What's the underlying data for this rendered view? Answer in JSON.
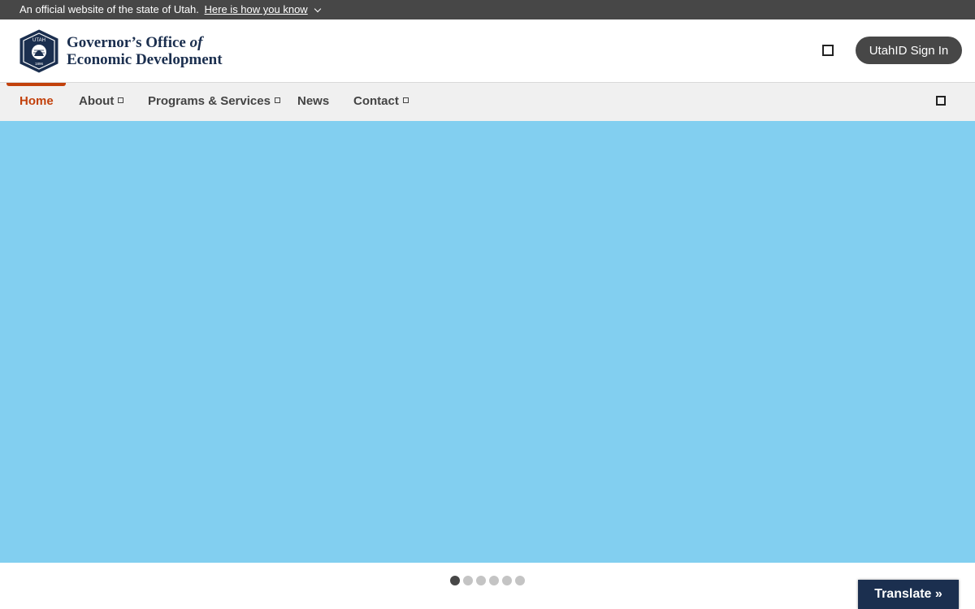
{
  "banner": {
    "text": "An official website of the state of Utah.",
    "link": "Here is how you know"
  },
  "header": {
    "logo_seal_text": "UTAH",
    "logo_year": "1896",
    "title_line1": "Governor’s Office",
    "title_line1_italic": "of",
    "title_line2": "Economic Development",
    "signin_label": "UtahID Sign In"
  },
  "nav": {
    "items": [
      {
        "label": "Home"
      },
      {
        "label": "About"
      },
      {
        "label": "Programs & Services"
      },
      {
        "label": "News"
      },
      {
        "label": "Contact"
      }
    ]
  },
  "carousel": {
    "slide_count": 6,
    "active_index": 0
  },
  "translate": {
    "label": "Translate »"
  },
  "colors": {
    "banner_bg": "#474747",
    "accent": "#c2410c",
    "brand_navy": "#1b2f4f",
    "hero_bg": "#82cff0",
    "nav_bg": "#f0f0f0"
  }
}
